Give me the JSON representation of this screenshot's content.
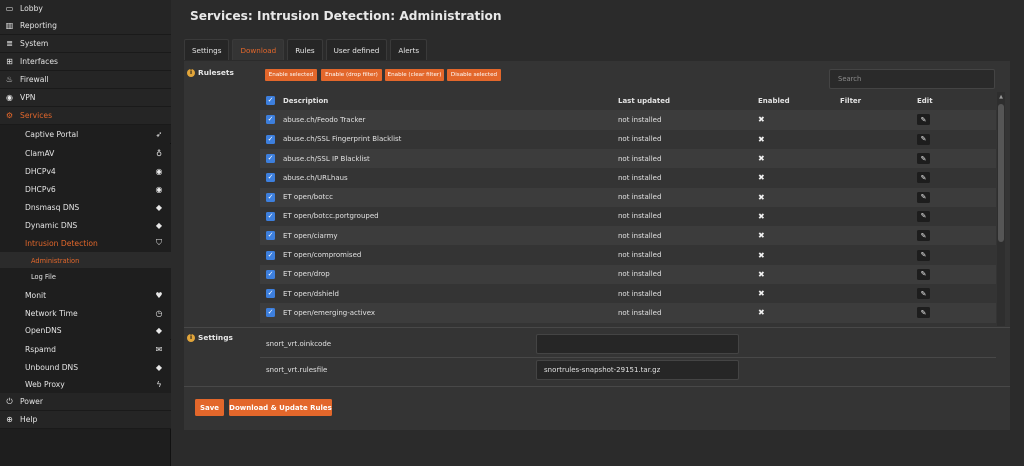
{
  "sidebar": {
    "items": [
      {
        "name": "lobby",
        "label": "Lobby",
        "icon": "laptop-icon",
        "glyph": "▭"
      },
      {
        "name": "reporting",
        "label": "Reporting",
        "icon": "chart-icon",
        "glyph": "▥"
      },
      {
        "name": "system",
        "label": "System",
        "icon": "server-icon",
        "glyph": "≣"
      },
      {
        "name": "interfaces",
        "label": "Interfaces",
        "icon": "sitemap-icon",
        "glyph": "⊞"
      },
      {
        "name": "firewall",
        "label": "Firewall",
        "icon": "fire-icon",
        "glyph": "♨"
      },
      {
        "name": "vpn",
        "label": "VPN",
        "icon": "globe-icon",
        "glyph": "◉"
      },
      {
        "name": "services",
        "label": "Services",
        "icon": "cog-icon",
        "glyph": "⚙"
      }
    ],
    "services_sub": [
      {
        "name": "captive-portal",
        "label": "Captive Portal",
        "icon": "paper-plane-icon",
        "glyph": "➶"
      },
      {
        "name": "clamav",
        "label": "ClamAV",
        "icon": "stethoscope-icon",
        "glyph": "♁"
      },
      {
        "name": "dhcpv4",
        "label": "DHCPv4",
        "icon": "bullseye-icon",
        "glyph": "◉"
      },
      {
        "name": "dhcpv6",
        "label": "DHCPv6",
        "icon": "bullseye-icon",
        "glyph": "◉"
      },
      {
        "name": "dnsmasq-dns",
        "label": "Dnsmasq DNS",
        "icon": "tags-icon",
        "glyph": "◆"
      },
      {
        "name": "dynamic-dns",
        "label": "Dynamic DNS",
        "icon": "tags-icon",
        "glyph": "◆"
      },
      {
        "name": "intrusion-detection",
        "label": "Intrusion Detection",
        "icon": "shield-icon",
        "glyph": "⛉"
      }
    ],
    "ids_sub": [
      {
        "name": "administration",
        "label": "Administration"
      },
      {
        "name": "log-file",
        "label": "Log File"
      }
    ],
    "services_sub2": [
      {
        "name": "monit",
        "label": "Monit",
        "icon": "heartbeat-icon",
        "glyph": "♥"
      },
      {
        "name": "network-time",
        "label": "Network Time",
        "icon": "clock-icon",
        "glyph": "◷"
      },
      {
        "name": "opendns",
        "label": "OpenDNS",
        "icon": "tags-icon",
        "glyph": "◆"
      },
      {
        "name": "rspamd",
        "label": "Rspamd",
        "icon": "envelope-icon",
        "glyph": "✉"
      },
      {
        "name": "unbound-dns",
        "label": "Unbound DNS",
        "icon": "tags-icon",
        "glyph": "◆"
      },
      {
        "name": "web-proxy",
        "label": "Web Proxy",
        "icon": "bolt-icon",
        "glyph": "ϟ"
      }
    ],
    "bottom": [
      {
        "name": "power",
        "label": "Power",
        "icon": "plug-icon",
        "glyph": "⏻"
      },
      {
        "name": "help",
        "label": "Help",
        "icon": "life-ring-icon",
        "glyph": "⊕"
      }
    ]
  },
  "page": {
    "title": "Services: Intrusion Detection: Administration"
  },
  "tabs": [
    "Settings",
    "Download",
    "Rules",
    "User defined",
    "Alerts"
  ],
  "active_tab": "Download",
  "rulesets": {
    "label": "Rulesets",
    "buttons": [
      "Enable selected",
      "Enable (drop filter)",
      "Enable (clear filter)",
      "Disable selected"
    ],
    "search_placeholder": "Search",
    "columns": {
      "description": "Description",
      "last_updated": "Last updated",
      "enabled": "Enabled",
      "filter": "Filter",
      "edit": "Edit"
    },
    "rows": [
      {
        "description": "abuse.ch/Feodo Tracker",
        "last_updated": "not installed"
      },
      {
        "description": "abuse.ch/SSL Fingerprint Blacklist",
        "last_updated": "not installed"
      },
      {
        "description": "abuse.ch/SSL IP Blacklist",
        "last_updated": "not installed"
      },
      {
        "description": "abuse.ch/URLhaus",
        "last_updated": "not installed"
      },
      {
        "description": "ET open/botcc",
        "last_updated": "not installed"
      },
      {
        "description": "ET open/botcc.portgrouped",
        "last_updated": "not installed"
      },
      {
        "description": "ET open/ciarmy",
        "last_updated": "not installed"
      },
      {
        "description": "ET open/compromised",
        "last_updated": "not installed"
      },
      {
        "description": "ET open/drop",
        "last_updated": "not installed"
      },
      {
        "description": "ET open/dshield",
        "last_updated": "not installed"
      },
      {
        "description": "ET open/emerging-activex",
        "last_updated": "not installed"
      }
    ]
  },
  "settings": {
    "label": "Settings",
    "oinkcode_label": "snort_vrt.oinkcode",
    "oinkcode_value": "",
    "rulesfile_label": "snort_vrt.rulesfile",
    "rulesfile_value": "snortrules-snapshot-29151.tar.gz"
  },
  "actions": {
    "save": "Save",
    "download_update": "Download & Update Rules"
  },
  "colors": {
    "accent": "#e3672b",
    "checkbox": "#3d7fdd"
  }
}
